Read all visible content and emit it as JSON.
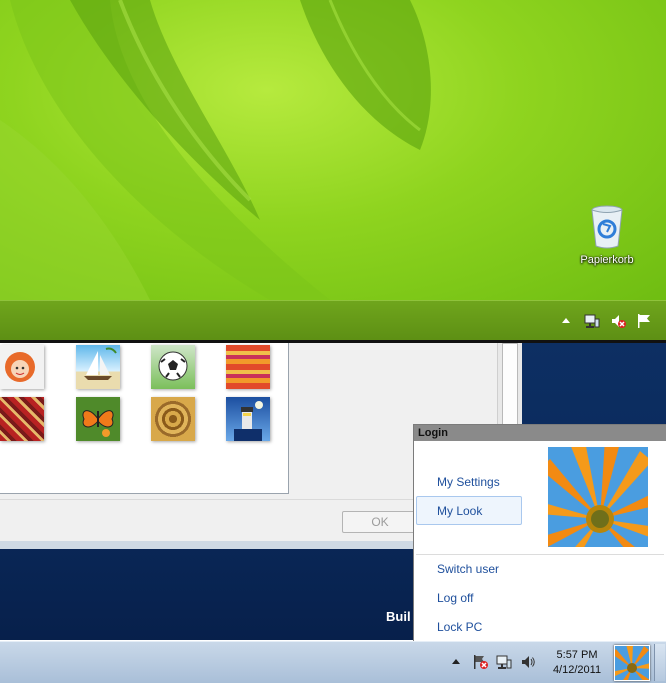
{
  "desktop": {
    "recycle_bin_label": "Papierkorb"
  },
  "top_tray": {
    "icons": [
      "up-arrow-icon",
      "network-icon",
      "volume-muted-icon",
      "action-center-flag-icon"
    ]
  },
  "window": {
    "ok_label": "OK",
    "pictures": [
      "doll-picture",
      "sailboat-picture",
      "soccer-ball-picture",
      "fabric-picture",
      "rug-picture",
      "butterfly-picture",
      "shell-picture",
      "lighthouse-picture"
    ]
  },
  "background_text": "Buil",
  "login": {
    "title": "Login",
    "items": [
      "My Settings",
      "My Look",
      "Switch user",
      "Log off",
      "Lock PC"
    ],
    "highlighted": "My Look"
  },
  "taskbar": {
    "time": "5:57 PM",
    "date": "4/12/2011",
    "icons": [
      "up-arrow-icon",
      "action-center-error-icon",
      "network-icon",
      "volume-icon"
    ]
  },
  "colors": {
    "link": "#1e4f9c",
    "desktop_green": "#8fd41f",
    "desktop_blue": "#0b2a5c"
  }
}
